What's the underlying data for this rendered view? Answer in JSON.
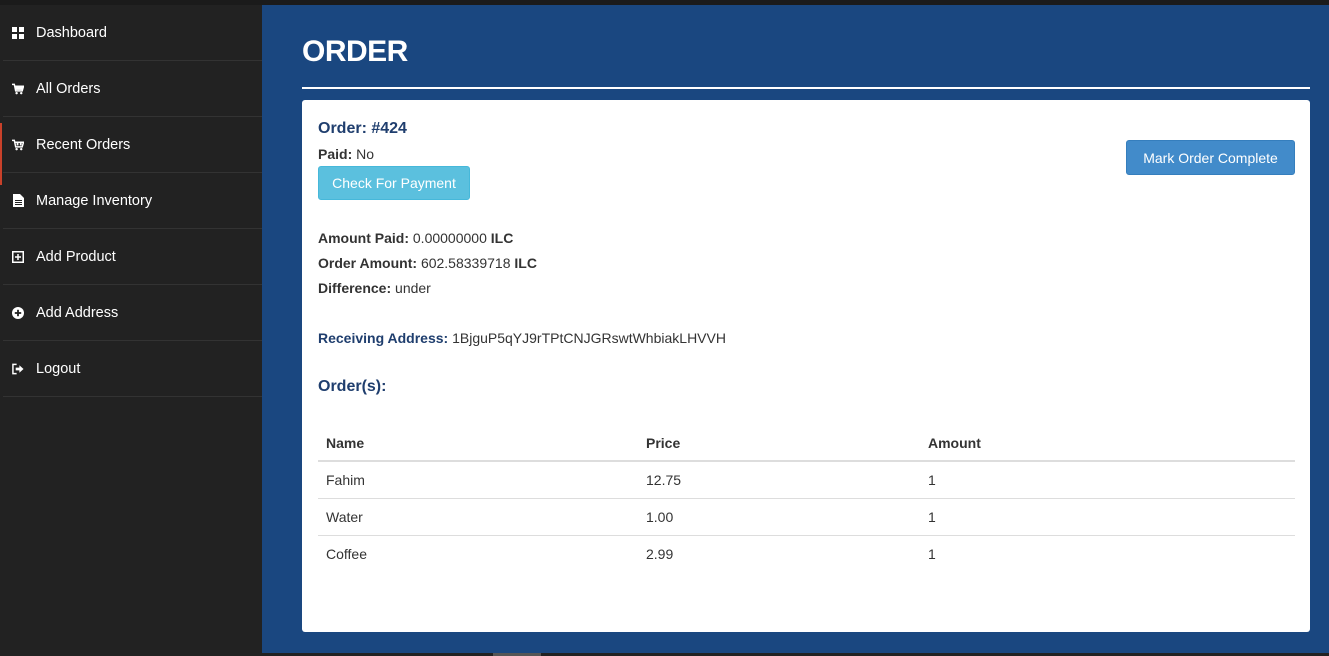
{
  "sidebar": {
    "items": [
      {
        "label": "Dashboard",
        "icon": "dashboard-icon"
      },
      {
        "label": "All Orders",
        "icon": "cart-icon"
      },
      {
        "label": "Recent Orders",
        "icon": "cart-icon"
      },
      {
        "label": "Manage Inventory",
        "icon": "document-icon"
      },
      {
        "label": "Add Product",
        "icon": "plus-square-icon"
      },
      {
        "label": "Add Address",
        "icon": "plus-circle-icon"
      },
      {
        "label": "Logout",
        "icon": "logout-icon"
      }
    ],
    "active_index": 2
  },
  "page": {
    "title": "ORDER"
  },
  "order": {
    "title": "Order: #424",
    "paid_label": "Paid:",
    "paid_value": "No",
    "check_payment_label": "Check For Payment",
    "mark_complete_label": "Mark Order Complete",
    "amount_paid_label": "Amount Paid:",
    "amount_paid_value": "0.00000000",
    "order_amount_label": "Order Amount:",
    "order_amount_value": "602.58339718",
    "currency": "ILC",
    "difference_label": "Difference:",
    "difference_value": "under",
    "receiving_address_label": "Receiving Address:",
    "receiving_address_value": "1BjguP5qYJ9rTPtCNJGRswtWhbiakLHVVH"
  },
  "items_table": {
    "heading": "Order(s):",
    "columns": [
      "Name",
      "Price",
      "Amount"
    ],
    "rows": [
      [
        "Fahim",
        "12.75",
        "1"
      ],
      [
        "Water",
        "1.00",
        "1"
      ],
      [
        "Coffee",
        "2.99",
        "1"
      ]
    ]
  },
  "colors": {
    "sidebar_bg": "#222222",
    "main_bg": "#1a4780",
    "heading_blue": "#1f3e6e",
    "info_button": "#5bc0de",
    "primary_button": "#428bca",
    "active_marker": "#c9412a"
  }
}
